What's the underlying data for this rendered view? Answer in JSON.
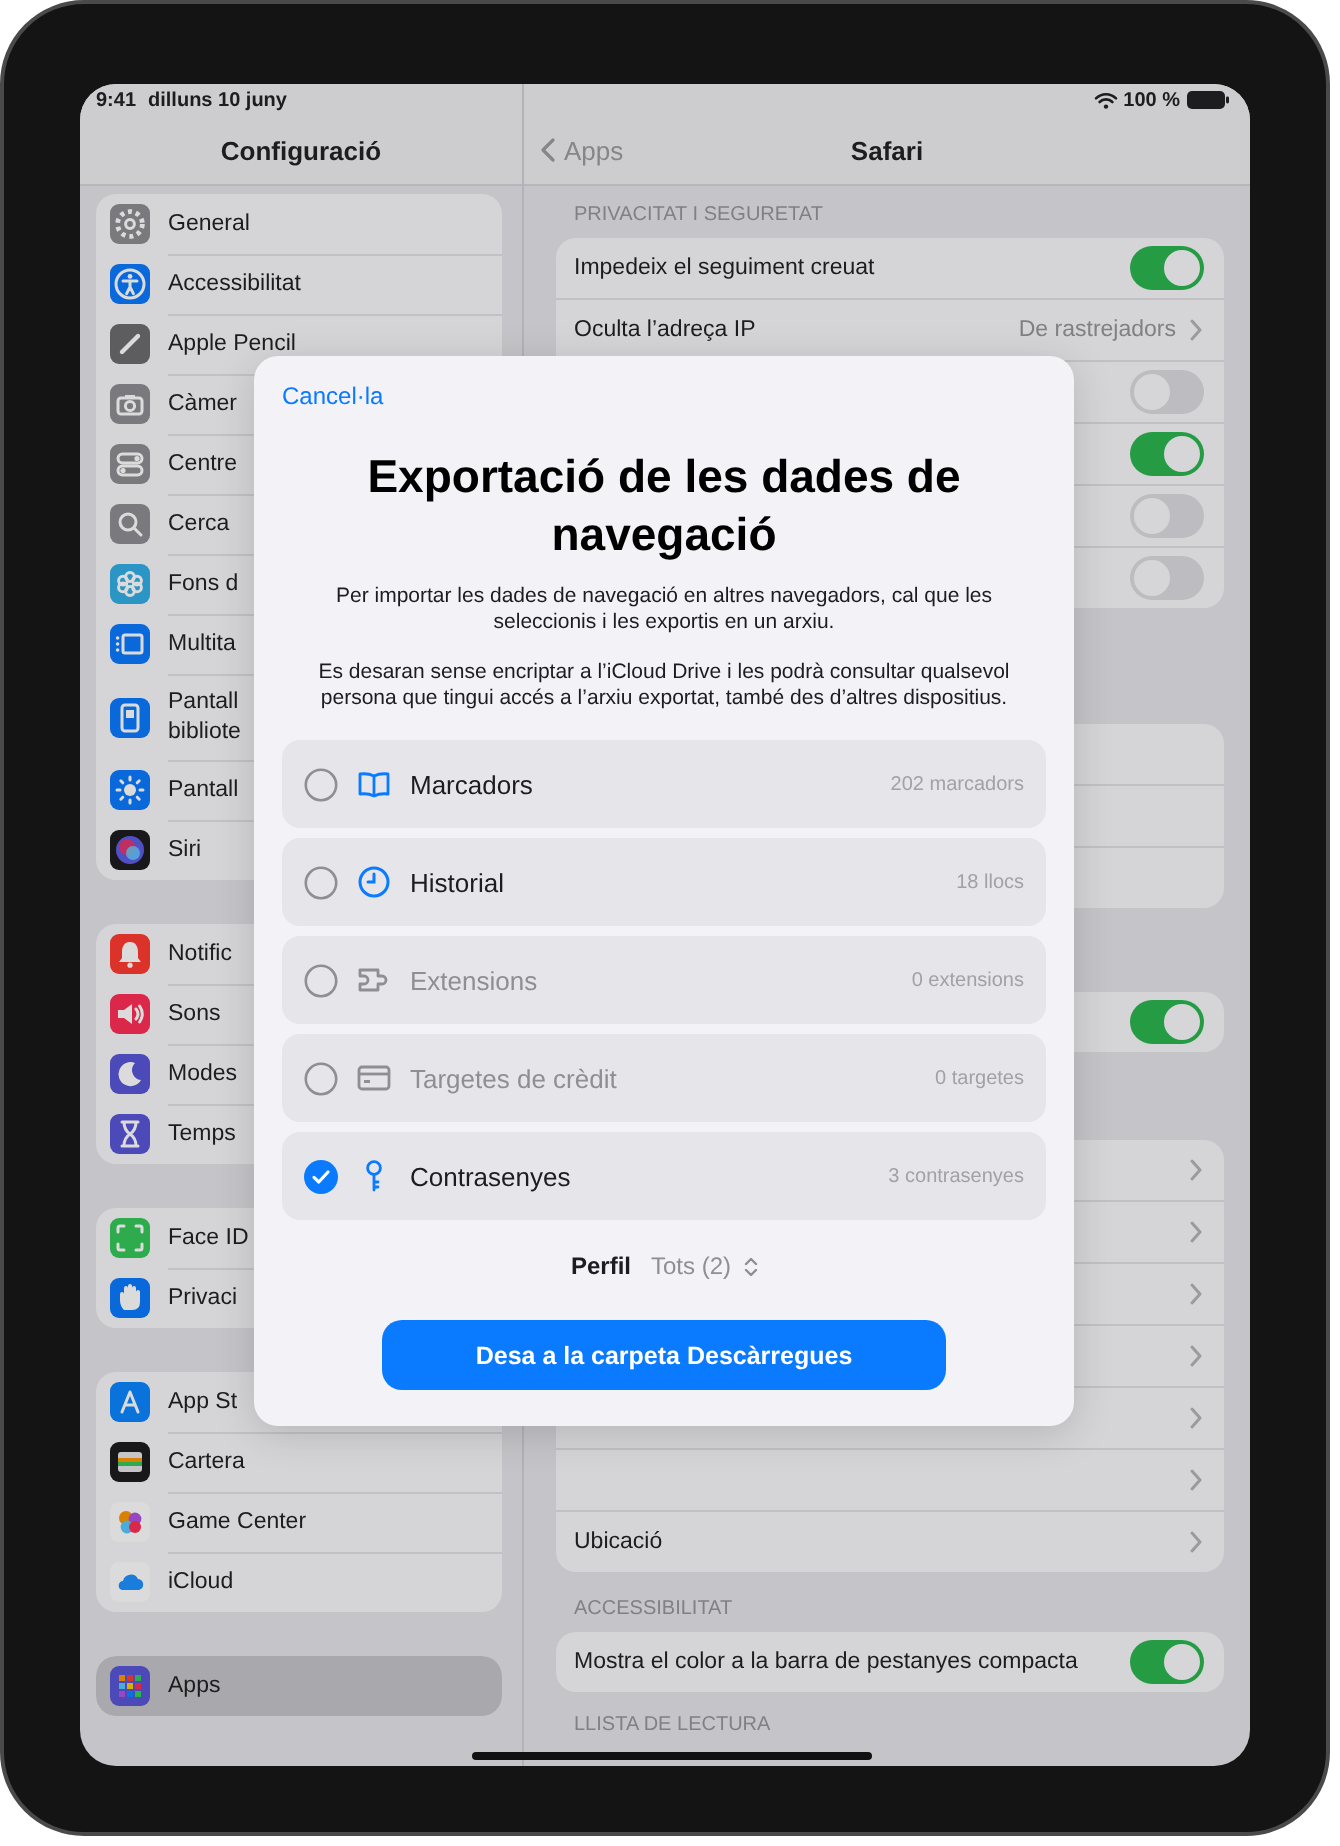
{
  "status_bar": {
    "time": "9:41",
    "date": "dilluns 10 juny",
    "battery": "100 %"
  },
  "sidebar": {
    "title": "Configuració",
    "groups": [
      {
        "items": [
          {
            "label": "General",
            "selected": false
          },
          {
            "label": "Accessibilitat",
            "selected": false
          },
          {
            "label": "Apple Pencil",
            "selected": false
          },
          {
            "label": "Càmer",
            "selected": false
          },
          {
            "label": "Centre",
            "selected": false
          },
          {
            "label": "Cerca",
            "selected": false
          },
          {
            "label": "Fons d",
            "selected": false
          },
          {
            "label": "Multita",
            "selected": false
          },
          {
            "label": "Pantall\nbibliote",
            "selected": false
          },
          {
            "label": "Pantall",
            "selected": false
          },
          {
            "label": "Siri",
            "selected": false
          }
        ]
      },
      {
        "items": [
          {
            "label": "Notific",
            "selected": false
          },
          {
            "label": "Sons",
            "selected": false
          },
          {
            "label": "Modes",
            "selected": false
          },
          {
            "label": "Temps",
            "selected": false
          }
        ]
      },
      {
        "items": [
          {
            "label": "Face ID",
            "selected": false
          },
          {
            "label": "Privaci",
            "selected": false
          }
        ]
      },
      {
        "items": [
          {
            "label": "App St",
            "selected": false
          },
          {
            "label": "Cartera",
            "selected": false
          },
          {
            "label": "Game Center",
            "selected": false
          },
          {
            "label": "iCloud",
            "selected": false
          }
        ]
      },
      {
        "items": [
          {
            "label": "Apps",
            "selected": true
          }
        ]
      }
    ]
  },
  "detail": {
    "back": "Apps",
    "title": "Safari",
    "sections": [
      {
        "header": "PRIVACITAT I SEGURETAT",
        "rows": [
          {
            "kind": "toggle",
            "label": "Impedeix el seguiment creuat",
            "on": true
          },
          {
            "kind": "value",
            "label": "Oculta l’adreça IP",
            "value": "De rastrejadors"
          },
          {
            "kind": "toggle",
            "on": false
          },
          {
            "kind": "toggle",
            "on": true
          },
          {
            "kind": "toggle",
            "on": false
          },
          {
            "kind": "toggle",
            "on": false
          }
        ]
      },
      {
        "rows": [
          {
            "kind": "blank"
          },
          {
            "kind": "blank"
          },
          {
            "kind": "blank"
          }
        ]
      },
      {
        "rows": [
          {
            "kind": "toggle",
            "on": true
          }
        ]
      },
      {
        "rows": [
          {
            "kind": "link"
          },
          {
            "kind": "link"
          },
          {
            "kind": "link"
          },
          {
            "kind": "link"
          },
          {
            "kind": "link"
          },
          {
            "kind": "link"
          },
          {
            "kind": "link",
            "label": "Ubicació"
          }
        ]
      },
      {
        "header": "ACCESSIBILITAT",
        "rows": [
          {
            "kind": "toggle",
            "label": "Mostra el color a la barra de pestanyes compacta",
            "on": true
          }
        ]
      },
      {
        "header": "LLISTA DE LECTURA"
      }
    ]
  },
  "modal": {
    "cancel": "Cancel·la",
    "title": "Exportació de les dades de navegació",
    "paragraphs": [
      "Per importar les dades de navegació en altres navegadors, cal que les seleccionis i les exportis en un arxiu.",
      "Es desaran sense encriptar a l’iCloud Drive i les podrà consultar qualsevol persona que tingui accés a l’arxiu exportat, també des d’altres dispositius."
    ],
    "options": [
      {
        "label": "Marcadors",
        "count": "202 marcadors",
        "selected": false,
        "disabled": false
      },
      {
        "label": "Historial",
        "count": "18 llocs",
        "selected": false,
        "disabled": false
      },
      {
        "label": "Extensions",
        "count": "0 extensions",
        "selected": false,
        "disabled": true
      },
      {
        "label": "Targetes de crèdit",
        "count": "0 targetes",
        "selected": false,
        "disabled": true
      },
      {
        "label": "Contrasenyes",
        "count": "3 contrasenyes",
        "selected": true,
        "disabled": false
      }
    ],
    "profile": {
      "label": "Perfil",
      "value": "Tots (2)"
    },
    "button": "Desa a la carpeta Descàrregues"
  }
}
